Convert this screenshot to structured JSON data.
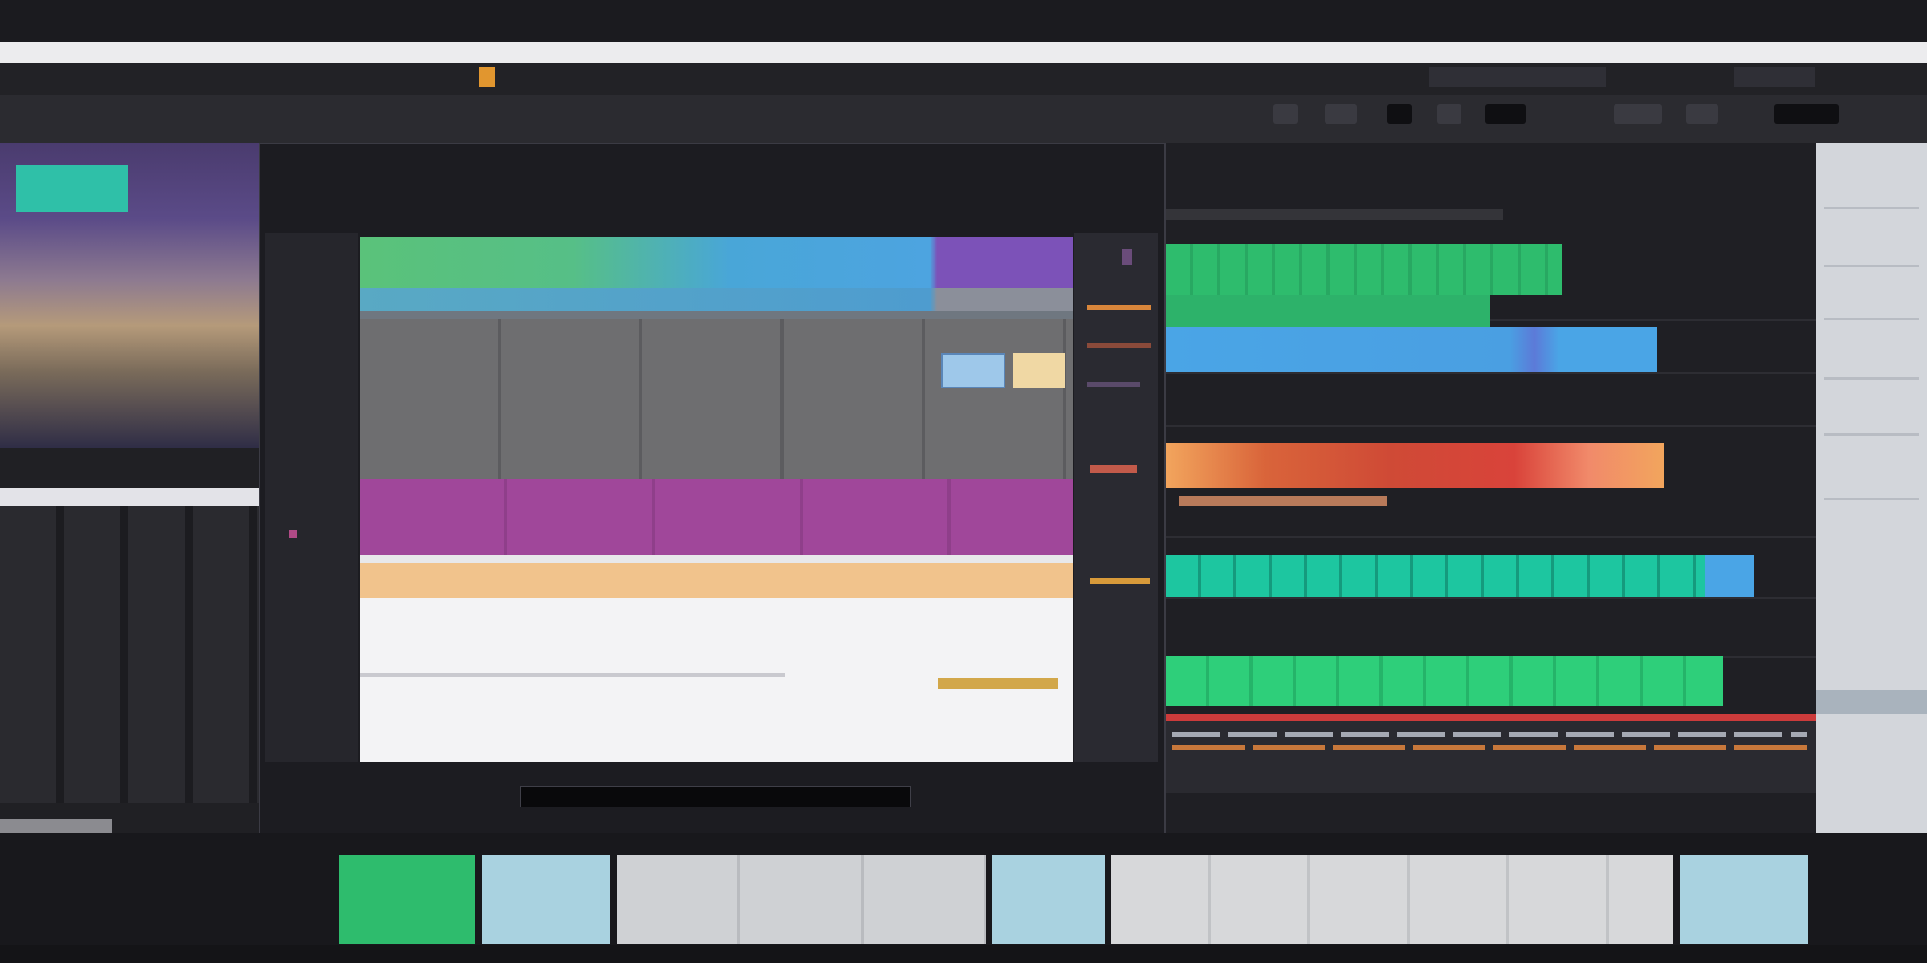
{
  "window": {
    "title": ""
  },
  "toolbar": {
    "search_placeholder": "",
    "timecode": ""
  },
  "dialog": {
    "title": "",
    "side_labels": [
      "",
      "",
      "",
      ""
    ],
    "preview_caption": "",
    "footer_button": ""
  },
  "timeline": {
    "ruler": ""
  },
  "colors": {
    "green_clip": "#2ecf7a",
    "blue_clip": "#4aa5e6",
    "red_clip": "#d9433a",
    "orange_clip": "#f2a55d",
    "teal_clip": "#1dc6a0",
    "purple_band": "#a0479a",
    "peach_band": "#f1c38c"
  }
}
